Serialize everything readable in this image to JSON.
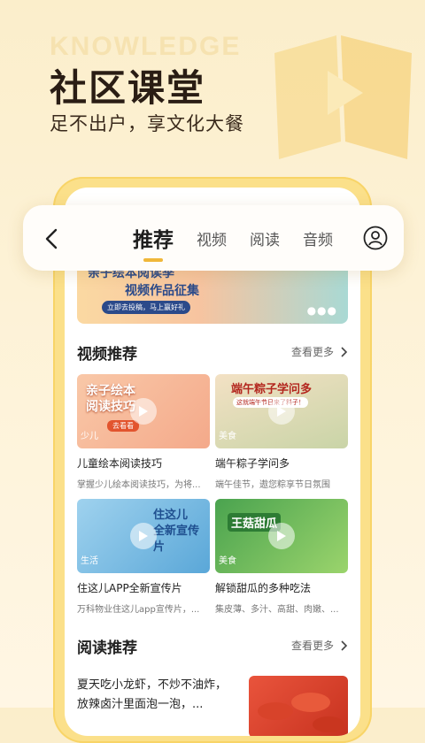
{
  "hero": {
    "bg_word": "KNOWLEDGE",
    "title": "社区课堂",
    "subtitle": "足不出户，享文化大餐"
  },
  "navbar": {
    "tabs": [
      {
        "label": "推荐",
        "active": true
      },
      {
        "label": "视频",
        "active": false
      },
      {
        "label": "阅读",
        "active": false
      },
      {
        "label": "音频",
        "active": false
      }
    ],
    "back_icon": "chevron-left-icon",
    "user_icon": "user-icon"
  },
  "banner": {
    "title_line1": "亲子绘本阅读季",
    "title_line2": "视频作品征集",
    "pill": "立即去投稿，马上赢好礼"
  },
  "video_section": {
    "title": "视频推荐",
    "more": "查看更多",
    "cards": [
      {
        "thumb_text": "亲子绘本\n阅读技巧",
        "thumb_button": "去看看",
        "tag": "少儿",
        "title": "儿童绘本阅读技巧",
        "desc": "掌握少儿绘本阅读技巧，为将..."
      },
      {
        "thumb_text": "端午粽子学问多",
        "thumb_sub": "这就端午节日来了料子！",
        "tag": "美食",
        "title": "端午粽子学问多",
        "desc": "端午佳节，遨您粽享节日氛围"
      },
      {
        "thumb_text": "住这儿\n全新宣传片",
        "tag": "生活",
        "title": "住这儿APP全新宣传片",
        "desc": "万科物业住这儿app宣传片，..."
      },
      {
        "thumb_text": "王菇甜瓜",
        "tag": "美食",
        "title": "解锁甜瓜的多种吃法",
        "desc": "集皮薄、多汁、高甜、肉嫩、..."
      }
    ]
  },
  "read_section": {
    "title": "阅读推荐",
    "more": "查看更多",
    "item": {
      "text": "夏天吃小龙虾，不炒不油炸，放辣卤汁里面泡一泡，..."
    }
  },
  "colors": {
    "accent": "#f0b73a",
    "phone_frame": "#fbe08a",
    "background": "#fbeecb"
  }
}
